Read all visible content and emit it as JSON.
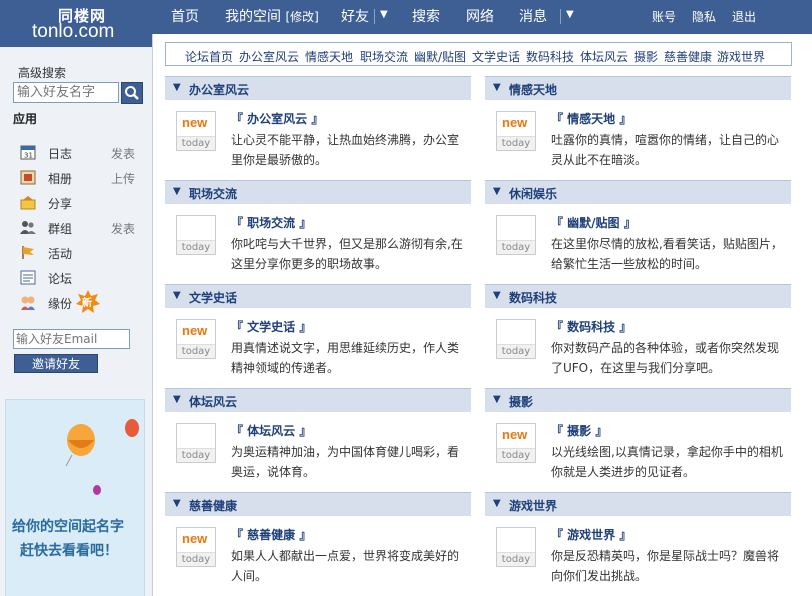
{
  "logo": {
    "cn": "同楼网",
    "en": "tonlo.com"
  },
  "topnav": {
    "home": "首页",
    "my_space": "我的空间",
    "edit": "[修改]",
    "friends": "好友",
    "search": "搜索",
    "network": "网络",
    "messages": "消息",
    "account": "账号",
    "privacy": "隐私",
    "logout": "退出"
  },
  "sidebar": {
    "advanced_search": "高级搜索",
    "search_placeholder": "输入好友名字",
    "apps_title": "应用",
    "apps": [
      {
        "label": "日志",
        "action": "发表",
        "icon": "calendar-icon"
      },
      {
        "label": "相册",
        "action": "上传",
        "icon": "photo-icon"
      },
      {
        "label": "分享",
        "action": "",
        "icon": "share-icon"
      },
      {
        "label": "群组",
        "action": "发表",
        "icon": "group-icon"
      },
      {
        "label": "活动",
        "action": "",
        "icon": "flag-icon"
      },
      {
        "label": "论坛",
        "action": "",
        "icon": "forum-icon"
      },
      {
        "label": "缘份",
        "action": "",
        "icon": "couple-icon",
        "badge": "新"
      }
    ],
    "invite_placeholder": "输入好友Email",
    "invite_button": "邀请好友",
    "banner": {
      "line1": "给你的空间起名字",
      "line2": "赶快去看看吧！"
    }
  },
  "categories": [
    "论坛首页",
    "办公室风云",
    "情感天地",
    "职场交流",
    "幽默/贴图",
    "文学史话",
    "数码科技",
    "体坛风云",
    "摄影",
    "慈善健康",
    "游戏世界"
  ],
  "sections": [
    {
      "header": "办公室风云",
      "title": "『 办公室风云 』",
      "desc": "让心灵不能平静，让热血始终沸腾，办公室里你是最骄傲的。",
      "new": "new",
      "today": "today"
    },
    {
      "header": "情感天地",
      "title": "『 情感天地 』",
      "desc": "吐露你的真情，喧嚣你的情绪，让自己的心灵从此不在暗淡。",
      "new": "new",
      "today": "today"
    },
    {
      "header": "职场交流",
      "title": "『 职场交流 』",
      "desc": "你叱咤与大千世界，但又是那么游彻有余,在这里分享你更多的职场故事。",
      "new": "",
      "today": "today"
    },
    {
      "header": "休闲娱乐",
      "title": "『 幽默/贴图 』",
      "desc": "在这里你尽情的放松,看看笑话，贴贴图片，给繁忙生活一些放松的时间。",
      "new": "",
      "today": "today"
    },
    {
      "header": "文学史话",
      "title": "『 文学史话 』",
      "desc": "用真情述说文字，用思维延续历史，作人类精神领域的传递者。",
      "new": "new",
      "today": "today"
    },
    {
      "header": "数码科技",
      "title": "『 数码科技 』",
      "desc": "你对数码产品的各种体验，或者你突然发现了UFO，在这里与我们分享吧。",
      "new": "",
      "today": "today"
    },
    {
      "header": "体坛风云",
      "title": "『 体坛风云 』",
      "desc": "为奥运精神加油，为中国体育健儿喝彩，看奥运，说体育。",
      "new": "",
      "today": "today"
    },
    {
      "header": "摄影",
      "title": "『 摄影 』",
      "desc": "以光线绘图,以真情记录，拿起你手中的相机你就是人类进步的见证者。",
      "new": "new",
      "today": "today"
    },
    {
      "header": "慈善健康",
      "title": "『 慈善健康 』",
      "desc": "如果人人都献出一点爱，世界将变成美好的人间。",
      "new": "new",
      "today": "today"
    },
    {
      "header": "游戏世界",
      "title": "『 游戏世界 』",
      "desc": "你是反恐精英吗，你是星际战士吗？魔兽将向你们发出挑战。",
      "new": "",
      "today": "today"
    }
  ],
  "colors": {
    "nav_bg": "#3e5f93",
    "section_head": "#d6dfeb",
    "link": "#20407a",
    "new": "#e67a10"
  }
}
